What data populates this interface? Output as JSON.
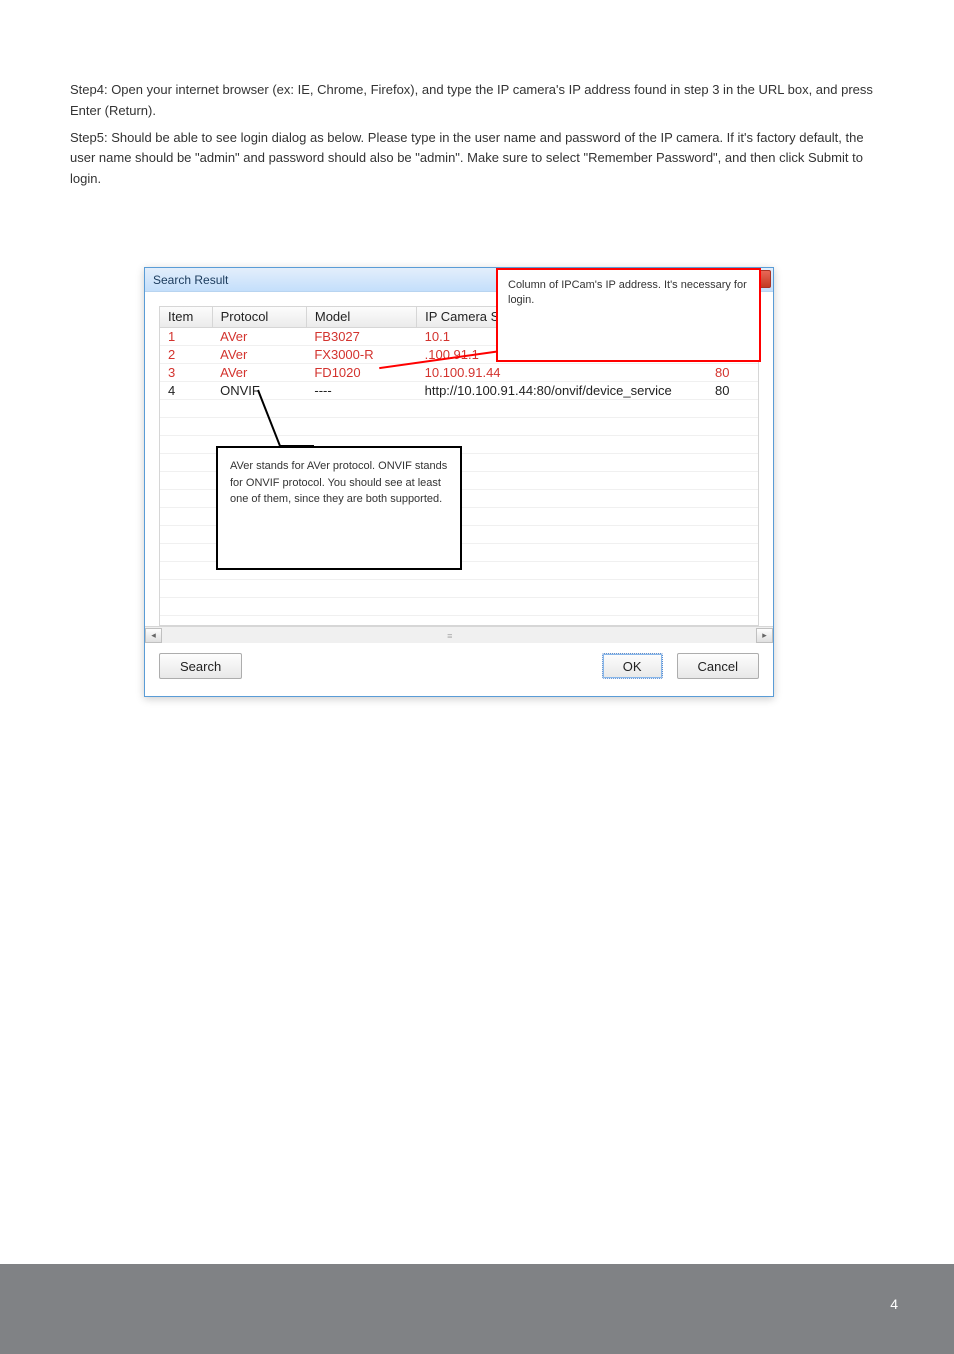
{
  "instructions": {
    "p1": "Step4: Open your internet browser (ex: IE, Chrome, Firefox), and type the IP camera's IP address found in step 3 in the URL box, and press Enter (Return).",
    "p2": "Step5: Should be able to see login dialog as below. Please type in the user name and password of the IP camera. If it's factory default, the user name should be \"admin\" and password should also be \"admin\". Make sure to select \"Remember Password\", and then click Submit to login."
  },
  "dialog": {
    "title": "Search Result",
    "close_label": "✕",
    "headers": {
      "item": "Item",
      "protocol": "Protocol",
      "model": "Model",
      "ip": "IP Camera S"
    },
    "rows": [
      {
        "item": "1",
        "protocol": "AVer",
        "model": "FB3027",
        "ip": "10.1",
        "extra": "",
        "red": true
      },
      {
        "item": "2",
        "protocol": "AVer",
        "model": "FX3000-R",
        "ip": "      .100.91.1",
        "extra": "",
        "red": true
      },
      {
        "item": "3",
        "protocol": "AVer",
        "model": "FD1020",
        "ip": "10.100.91.44",
        "extra": "80",
        "red": true
      },
      {
        "item": "4",
        "protocol": "ONVIF",
        "model": "----",
        "ip": "http://10.100.91.44:80/onvif/device_service",
        "extra": "80",
        "red": false
      }
    ],
    "buttons": {
      "search": "Search",
      "ok": "OK",
      "cancel": "Cancel"
    }
  },
  "callouts": {
    "red": "Column of IPCam's IP address. It's necessary for login.",
    "black": "AVer stands for AVer protocol. ONVIF stands for ONVIF protocol. You should see at least one of them, since they are both supported."
  },
  "footer": {
    "page": "4"
  }
}
